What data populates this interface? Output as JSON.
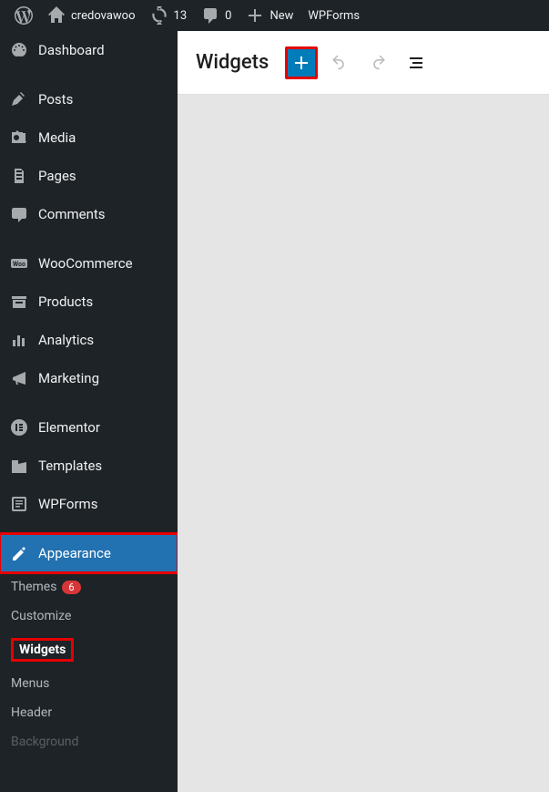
{
  "adminbar": {
    "site_name": "credovawoo",
    "updates_count": "13",
    "comments_count": "0",
    "new_label": "New",
    "wpforms_label": "WPForms"
  },
  "sidebar": {
    "items": [
      {
        "label": "Dashboard",
        "icon": "dashboard"
      },
      {
        "label": "Posts",
        "icon": "pin"
      },
      {
        "label": "Media",
        "icon": "media"
      },
      {
        "label": "Pages",
        "icon": "pages"
      },
      {
        "label": "Comments",
        "icon": "comments"
      },
      {
        "label": "WooCommerce",
        "icon": "woo"
      },
      {
        "label": "Products",
        "icon": "products"
      },
      {
        "label": "Analytics",
        "icon": "analytics"
      },
      {
        "label": "Marketing",
        "icon": "marketing"
      },
      {
        "label": "Elementor",
        "icon": "elementor"
      },
      {
        "label": "Templates",
        "icon": "templates"
      },
      {
        "label": "WPForms",
        "icon": "wpforms"
      },
      {
        "label": "Appearance",
        "icon": "appearance"
      }
    ],
    "submenu": {
      "themes": {
        "label": "Themes",
        "badge": "6"
      },
      "customize": {
        "label": "Customize"
      },
      "widgets": {
        "label": "Widgets"
      },
      "menus": {
        "label": "Menus"
      },
      "header": {
        "label": "Header"
      },
      "background": {
        "label": "Background"
      }
    }
  },
  "content": {
    "title": "Widgets"
  }
}
